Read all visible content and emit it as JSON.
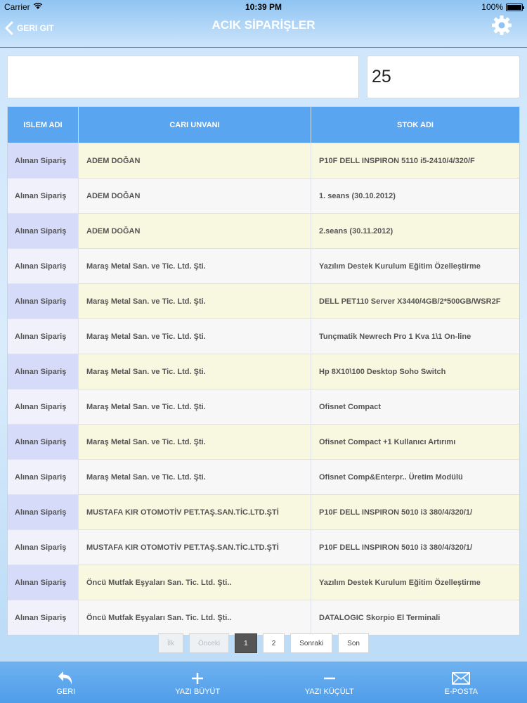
{
  "statusbar": {
    "carrier": "Carrier",
    "time": "10:39 PM",
    "battery": "100%"
  },
  "nav": {
    "back_label": "GERI GIT",
    "title": "ACIK SİPARİŞLER"
  },
  "search": {
    "value": "",
    "count": "25"
  },
  "table": {
    "headers": [
      "ISLEM ADI",
      "CARI UNVANI",
      "STOK ADI"
    ],
    "rows": [
      [
        "Alınan Sipariş",
        "ADEM DOĞAN",
        "P10F DELL INSPIRON 5110 i5-2410/4/320/F"
      ],
      [
        "Alınan Sipariş",
        "ADEM DOĞAN",
        "1. seans (30.10.2012)"
      ],
      [
        "Alınan Sipariş",
        "ADEM DOĞAN",
        "2.seans (30.11.2012)"
      ],
      [
        "Alınan Sipariş",
        "Maraş Metal San. ve Tic. Ltd. Şti.",
        "Yazılım Destek Kurulum Eğitim Özelleştirme"
      ],
      [
        "Alınan Sipariş",
        "Maraş Metal San. ve Tic. Ltd. Şti.",
        "DELL PET110 Server X3440/4GB/2*500GB/WSR2F"
      ],
      [
        "Alınan Sipariş",
        "Maraş Metal San. ve Tic. Ltd. Şti.",
        "Tunçmatik Newrech Pro 1 Kva 1\\1 On-line"
      ],
      [
        "Alınan Sipariş",
        "Maraş Metal San. ve Tic. Ltd. Şti.",
        "Hp 8X10\\100 Desktop Soho Switch"
      ],
      [
        "Alınan Sipariş",
        "Maraş Metal San. ve Tic. Ltd. Şti.",
        "Ofisnet Compact"
      ],
      [
        "Alınan Sipariş",
        "Maraş Metal San. ve Tic. Ltd. Şti.",
        "Ofisnet Compact +1 Kullanıcı Artırımı"
      ],
      [
        "Alınan Sipariş",
        "Maraş Metal San. ve Tic. Ltd. Şti.",
        "Ofisnet Comp&Enterpr.. Üretim Modülü"
      ],
      [
        "Alınan Sipariş",
        "MUSTAFA KIR OTOMOTİV PET.TAŞ.SAN.TİC.LTD.ŞTİ",
        "P10F DELL INSPIRON 5010 i3 380/4/320/1/"
      ],
      [
        "Alınan Sipariş",
        "MUSTAFA KIR OTOMOTİV PET.TAŞ.SAN.TİC.LTD.ŞTİ",
        "P10F DELL INSPIRON 5010 i3 380/4/320/1/"
      ],
      [
        "Alınan Sipariş",
        "Öncü Mutfak Eşyaları San. Tic. Ltd. Şti..",
        "Yazılım Destek Kurulum Eğitim Özelleştirme"
      ],
      [
        "Alınan Sipariş",
        "Öncü Mutfak Eşyaları San. Tic. Ltd. Şti..",
        "DATALOGIC Skorpio El Terminali"
      ]
    ]
  },
  "pager": {
    "first": "İlk",
    "prev": "Önceki",
    "pages": [
      "1",
      "2"
    ],
    "next": "Sonraki",
    "last": "Son"
  },
  "toolbar": {
    "items": [
      {
        "label": "GERI",
        "icon": "undo-arrow-icon"
      },
      {
        "label": "YAZI BÜYÜT",
        "icon": "plus-icon"
      },
      {
        "label": "YAZI KÜÇÜLT",
        "icon": "minus-icon"
      },
      {
        "label": "E-POSTA",
        "icon": "envelope-icon"
      }
    ]
  },
  "colors": {
    "header": "#59a5f0",
    "toolbar": "#5aa5ec",
    "active_page": "#555555"
  }
}
